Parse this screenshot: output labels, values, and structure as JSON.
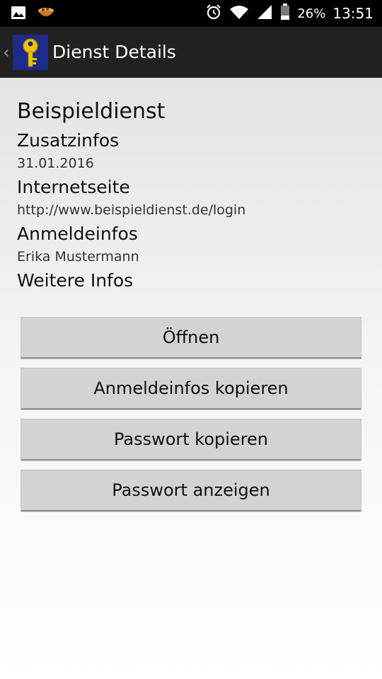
{
  "status_bar": {
    "battery": "26%",
    "time": "13:51",
    "icons": [
      "gallery-icon",
      "bowl-icon",
      "alarm-icon",
      "wifi-icon",
      "signal-icon",
      "battery-icon"
    ]
  },
  "action_bar": {
    "title": "Dienst Details",
    "back_symbol": "‹"
  },
  "details": {
    "service_name": "Beispieldienst",
    "extra_label": "Zusatzinfos",
    "extra_value": "31.01.2016",
    "website_label": "Internetseite",
    "website_value": "http://www.beispieldienst.de/login",
    "login_label": "Anmeldeinfos",
    "login_value": "Erika Mustermann",
    "more_label": "Weitere Infos"
  },
  "buttons": {
    "open": "Öffnen",
    "copy_login": "Anmeldeinfos kopieren",
    "copy_password": "Passwort kopieren",
    "show_password": "Passwort anzeigen"
  },
  "colors": {
    "status_bar": "#000000",
    "action_bar": "#212121",
    "icon_background": "#1d2b8a",
    "key": "#f2c400",
    "button": "#d3d3d3"
  }
}
